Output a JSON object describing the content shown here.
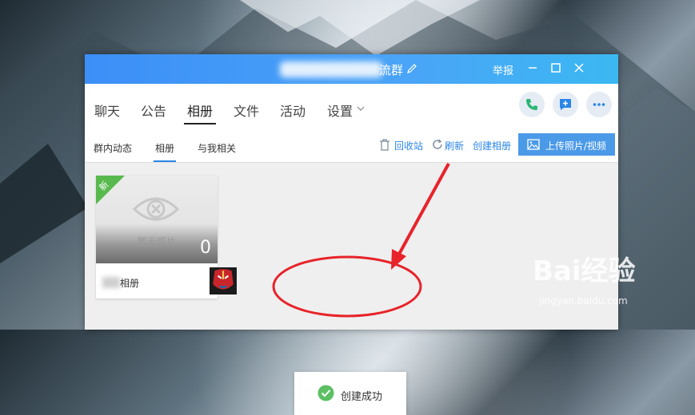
{
  "window": {
    "title_suffix": "流群",
    "report_label": "举报"
  },
  "nav": {
    "tabs": [
      {
        "label": "聊天"
      },
      {
        "label": "公告"
      },
      {
        "label": "相册"
      },
      {
        "label": "文件"
      },
      {
        "label": "活动"
      },
      {
        "label": "设置"
      }
    ],
    "active_tab": "相册"
  },
  "subnav": {
    "tabs": [
      {
        "label": "群内动态"
      },
      {
        "label": "相册"
      },
      {
        "label": "与我相关"
      }
    ],
    "recycle_label": "回收站",
    "refresh_label": "刷新",
    "create_album_label": "创建相册",
    "upload_label": "上传照片/视频"
  },
  "album": {
    "badge": "新",
    "empty_text": "暂无照片",
    "count": "0",
    "name": "相册"
  },
  "toast": {
    "message": "创建成功"
  },
  "watermark": {
    "brand": "Bai经验",
    "url": "jingyan.baidu.com"
  },
  "colors": {
    "accent": "#3c8ff7",
    "success": "#5cc063",
    "badge": "#58b94f",
    "annotation_red": "#e8232a"
  }
}
